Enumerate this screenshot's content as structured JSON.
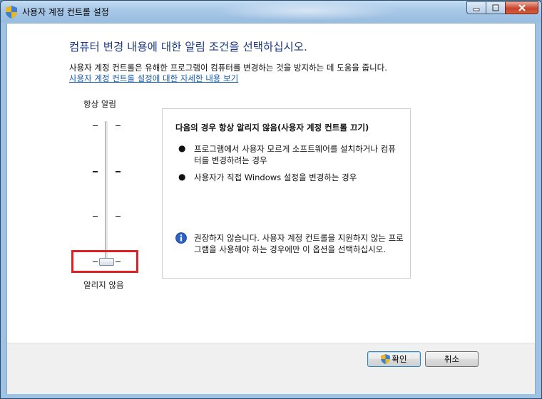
{
  "window": {
    "title": "사용자 계정 컨트롤 설정",
    "buttons": {
      "minimize": "minimize-icon",
      "maximize": "maximize-icon",
      "close": "close-icon"
    }
  },
  "content": {
    "heading": "컴퓨터 변경 내용에 대한 알림 조건을 선택하십시오.",
    "description": "사용자 계정 컨트롤은 유해한 프로그램이 컴퓨터를 변경하는 것을 방지하는 데 도움을 줍니다.",
    "link": "사용자 계정 컨트롤 설정에 대한 자세한 내용 보기"
  },
  "slider": {
    "top_label": "항상 알림",
    "bottom_label": "알리지 않음",
    "levels": 4,
    "selected_level": 1
  },
  "panel": {
    "title": "다음의 경우 항상 알리지 않음(사용자 계정 컨트롤 끄기)",
    "bullets": [
      "프로그램에서 사용자 모르게 소프트웨어를 설치하거나 컴퓨터를 변경하려는 경우",
      "사용자가 직접 Windows 설정을 변경하는 경우"
    ],
    "note": "권장하지 않습니다. 사용자 계정 컨트롤을 지원하지 않는 프로그램을 사용해야 하는 경우에만 이 옵션을 선택하십시오."
  },
  "footer": {
    "ok_label": "확인",
    "cancel_label": "취소"
  },
  "colors": {
    "heading": "#1d3a87",
    "link": "#1a5ea8",
    "highlight": "#e02020"
  }
}
